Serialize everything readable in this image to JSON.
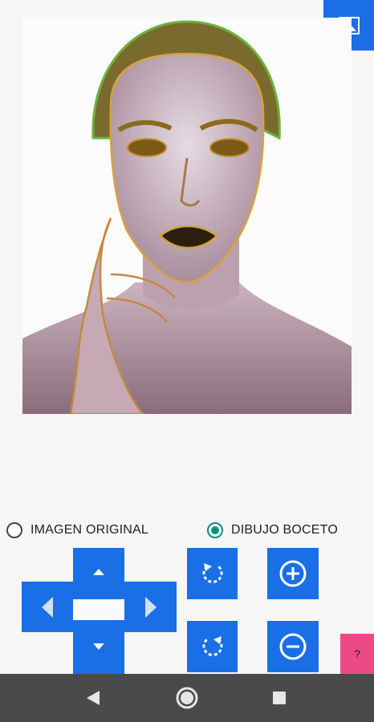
{
  "controls": {
    "original_label": "IMAGEN ORIGINAL",
    "sketch_label": "DIBUJO BOCETO",
    "selected": "DIBUJO BOCETO"
  },
  "help": {
    "label": "?"
  },
  "icons": {
    "gallery": "image-icon",
    "up": "arrow-up-icon",
    "down": "arrow-down-icon",
    "left": "arrow-left-icon",
    "right": "arrow-right-icon",
    "rotate_left": "rotate-left-icon",
    "rotate_right": "rotate-right-icon",
    "zoom_in": "zoom-in-icon",
    "zoom_out": "zoom-out-icon",
    "nav_back": "back-icon",
    "nav_home": "home-icon",
    "nav_recents": "recents-icon"
  },
  "colors": {
    "accent_blue": "#1a6fe6",
    "radio_selected": "#0f8f7a",
    "help_pink": "#ec4a86",
    "navbar": "#4a4a4a"
  }
}
